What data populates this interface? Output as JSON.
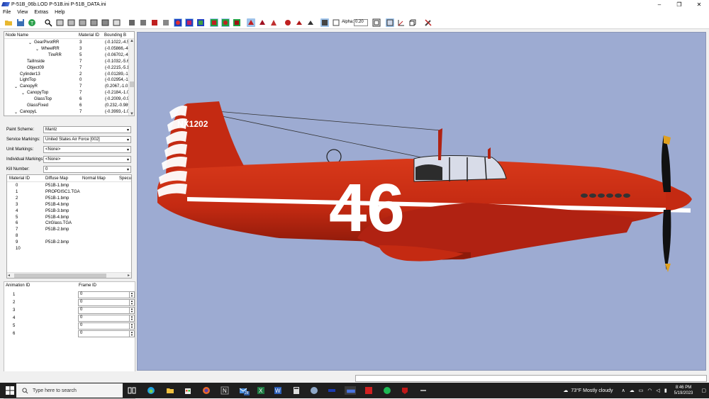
{
  "window": {
    "title": "P-51B_06b.LOD  P-51B.ini  P-51B_DATA.ini",
    "controls": [
      "–",
      "❐",
      "✕"
    ]
  },
  "menu": [
    "File",
    "View",
    "Extras",
    "Help"
  ],
  "toolbar": {
    "alpha_label": "Alpha:",
    "alpha_value": "0.20"
  },
  "node_tree": {
    "headers": [
      "Node Name",
      "Material ID",
      "Bounding B"
    ],
    "rows": [
      {
        "name": "GearPivotRR",
        "indent": 3,
        "toggle": "⌄",
        "mat": "3",
        "bb": "(-0.1022,-4.5"
      },
      {
        "name": "WheelRR",
        "indent": 4,
        "toggle": "⌄",
        "mat": "3",
        "bb": "(-0.05866,-4."
      },
      {
        "name": "TireRR",
        "indent": 5,
        "toggle": "",
        "mat": "5",
        "bb": "(-0.06702,-4."
      },
      {
        "name": "TailInside",
        "indent": 2,
        "toggle": "",
        "mat": "7",
        "bb": "(-0.1032,-5.6"
      },
      {
        "name": "Object09",
        "indent": 2,
        "toggle": "",
        "mat": "7",
        "bb": "(-0.2215,-5.1"
      },
      {
        "name": "Cylinder13",
        "indent": 1,
        "toggle": "",
        "mat": "2",
        "bb": "(-0.01289,-1."
      },
      {
        "name": "LightTop",
        "indent": 1,
        "toggle": "",
        "mat": "0",
        "bb": "(-0.02954,-1."
      },
      {
        "name": "CanopyR",
        "indent": 1,
        "toggle": "⌄",
        "mat": "7",
        "bb": "(0.2067,-1.01"
      },
      {
        "name": "CanopyTop",
        "indent": 2,
        "toggle": "⌄",
        "mat": "7",
        "bb": "(-0.2184,-1.0"
      },
      {
        "name": "GlassTop",
        "indent": 3,
        "toggle": "",
        "mat": "6",
        "bb": "(-0.2009,-0.9"
      },
      {
        "name": "GlassFixed",
        "indent": 2,
        "toggle": "",
        "mat": "6",
        "bb": "(0.232,-0.989"
      },
      {
        "name": "CanopyL",
        "indent": 1,
        "toggle": "⌄",
        "mat": "7",
        "bb": "(-0.3993,-1.0"
      }
    ]
  },
  "form": {
    "paint_scheme": {
      "label": "Paint Scheme:",
      "value": "Mantz"
    },
    "service_markings": {
      "label": "Service Markings:",
      "value": "United States Air Force [002]"
    },
    "unit_markings": {
      "label": "Unit Markings:",
      "value": "<None>"
    },
    "individual_markings": {
      "label": "Individual Markings:",
      "value": "<None>"
    },
    "kill_number": {
      "label": "Kill Number:",
      "value": "0"
    }
  },
  "materials": {
    "headers": [
      "Material ID",
      "Diffuse Map",
      "Normal Map",
      "Specu"
    ],
    "rows": [
      {
        "id": "0",
        "diffuse": "P51B-1.bmp"
      },
      {
        "id": "1",
        "diffuse": "PROPDISC1.TGA"
      },
      {
        "id": "2",
        "diffuse": "P51B-1.bmp"
      },
      {
        "id": "3",
        "diffuse": "P51B-4.bmp"
      },
      {
        "id": "4",
        "diffuse": "P51B-3.bmp"
      },
      {
        "id": "5",
        "diffuse": "P51B-4.bmp"
      },
      {
        "id": "6",
        "diffuse": "ClrGlass.TGA"
      },
      {
        "id": "7",
        "diffuse": "P51B-2.bmp"
      },
      {
        "id": "8",
        "diffuse": ""
      },
      {
        "id": "9",
        "diffuse": "P51B-2.bmp"
      },
      {
        "id": "10",
        "diffuse": ""
      }
    ]
  },
  "animation": {
    "headers": [
      "Animation ID",
      "Frame ID"
    ],
    "rows": [
      {
        "id": "1",
        "frame": "0"
      },
      {
        "id": "2",
        "frame": "0"
      },
      {
        "id": "3",
        "frame": "0"
      },
      {
        "id": "4",
        "frame": "0"
      },
      {
        "id": "5",
        "frame": "0"
      },
      {
        "id": "6",
        "frame": "0"
      }
    ]
  },
  "aircraft": {
    "registration": "NX1202",
    "race_number": "46",
    "colors": {
      "body": "#c42a12",
      "stripe": "#ffffff",
      "background": "#9dabd2"
    }
  },
  "taskbar": {
    "search_placeholder": "Type here to search",
    "weather": "73°F  Mostly cloudy",
    "time": "8:46 PM",
    "date": "5/19/2023",
    "badge": "28"
  }
}
